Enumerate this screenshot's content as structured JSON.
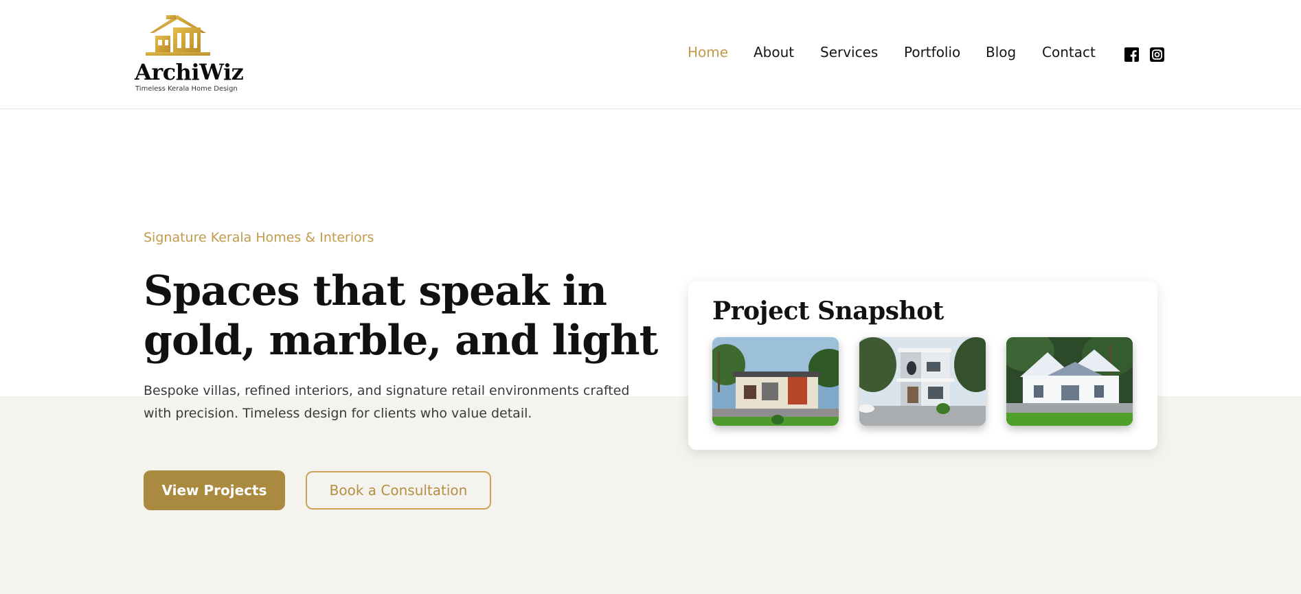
{
  "brand": {
    "name": "ArchiWiz",
    "tagline": "Timeless Kerala Home Design",
    "logo_icon": "house-outline-icon",
    "accent_color": "#c29a48"
  },
  "nav": {
    "items": [
      {
        "label": "Home",
        "active": true
      },
      {
        "label": "About",
        "active": false
      },
      {
        "label": "Services",
        "active": false
      },
      {
        "label": "Portfolio",
        "active": false
      },
      {
        "label": "Blog",
        "active": false
      },
      {
        "label": "Contact",
        "active": false
      }
    ],
    "social": [
      "facebook-icon",
      "instagram-icon"
    ]
  },
  "hero": {
    "eyebrow": "Signature Kerala Homes & Interiors",
    "title": "Spaces that speak in gold, marble, and light",
    "description": "Bespoke villas, refined interiors, and signature retail environments crafted with precision. Timeless design for clients who value detail.",
    "primary_button": "View Projects",
    "secondary_button": "Book a Consultation",
    "primary_color": "#aa8a3f",
    "background_band_color": "#f5f3ee"
  },
  "snapshot": {
    "title": "Project Snapshot",
    "photos": [
      "house-photo-1",
      "house-photo-2",
      "house-photo-3"
    ]
  }
}
